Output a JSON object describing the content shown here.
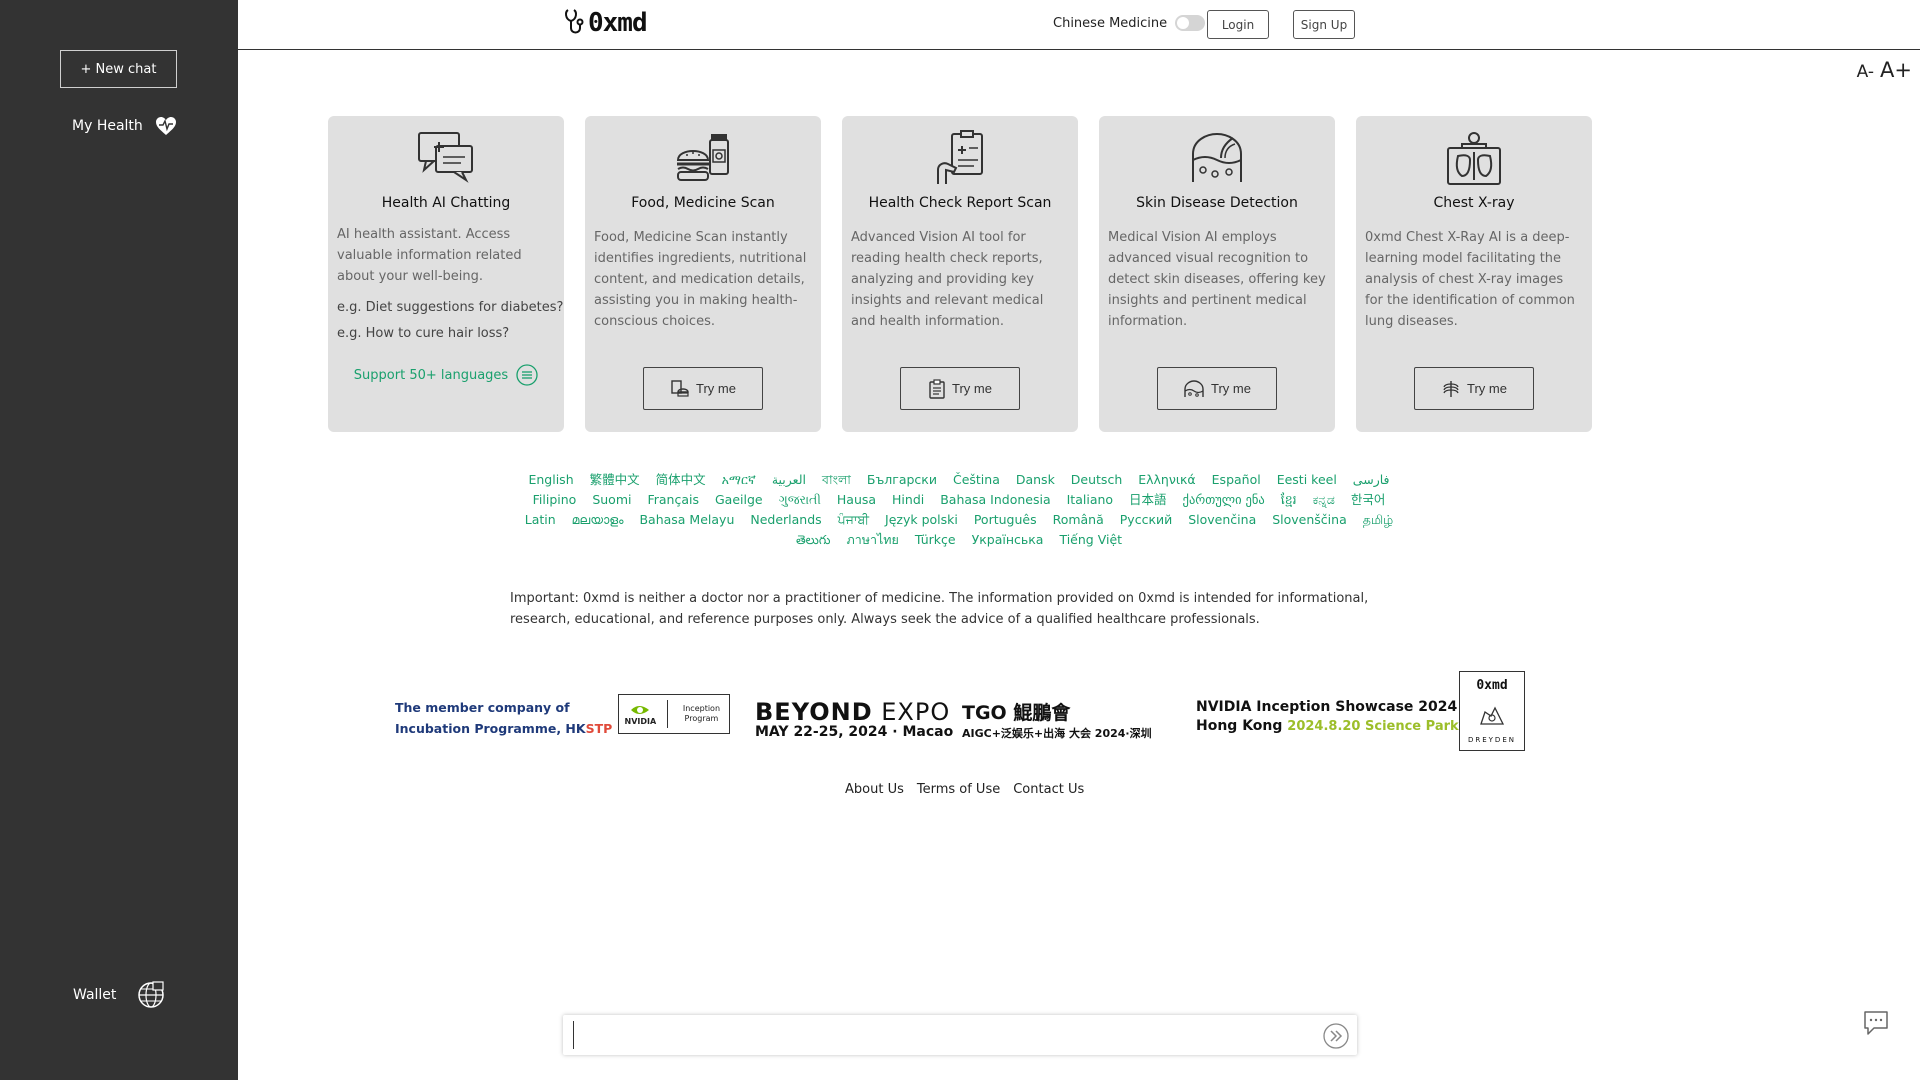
{
  "sidebar": {
    "new_chat": "+ New chat",
    "my_health": "My Health",
    "wallet": "Wallet"
  },
  "header": {
    "logo": "0xmd",
    "chinese_medicine": "Chinese Medicine",
    "login": "Login",
    "signup": "Sign Up",
    "font_smaller": "A-",
    "font_larger": "A+"
  },
  "cards": [
    {
      "title": "Health AI Chatting",
      "desc": "AI health assistant. Access valuable information related about your well-being.",
      "example1": "e.g. Diet suggestions for diabetes?",
      "example2": "e.g. How to cure hair loss?",
      "support": "Support 50+ languages"
    },
    {
      "title": "Food, Medicine Scan",
      "desc": "Food, Medicine Scan instantly identifies ingredients, nutritional content, and medication details, assisting you in making health-conscious choices.",
      "try": "Try me"
    },
    {
      "title": "Health Check Report Scan",
      "desc": "Advanced Vision AI tool for reading health check reports, analyzing and providing key insights and relevant medical and health information.",
      "try": "Try me"
    },
    {
      "title": "Skin Disease Detection",
      "desc": "Medical Vision AI employs advanced visual recognition to detect skin diseases, offering key insights and pertinent medical information.",
      "try": "Try me"
    },
    {
      "title": "Chest X-ray",
      "desc": "0xmd Chest X-Ray AI is a deep-learning model facilitating the analysis of chest X-ray images for the identification of common lung diseases.",
      "try": "Try me"
    }
  ],
  "languages": [
    "English",
    "繁體中文",
    "简体中文",
    "አማርኛ",
    "العربية",
    "বাংলা",
    "Български",
    "Čeština",
    "Dansk",
    "Deutsch",
    "Ελληνικά",
    "Español",
    "Eesti keel",
    "فارسی",
    "Filipino",
    "Suomi",
    "Français",
    "Gaeilge",
    "ગુજરાતી",
    "Hausa",
    "Hindi",
    "Bahasa Indonesia",
    "Italiano",
    "日本語",
    "ქართული ენა",
    "ខ្មែរ",
    "ಕನ್ನಡ",
    "한국어",
    "Latin",
    "മലയാളം",
    "Bahasa Melayu",
    "Nederlands",
    "ਪੰਜਾਬੀ",
    "Język polski",
    "Português",
    "Română",
    "Русский",
    "Slovenčina",
    "Slovenščina",
    "தமிழ்",
    "తెలుగు",
    "ภาษาไทย",
    "Türkçe",
    "Українська",
    "Tiếng Việt"
  ],
  "disclaimer": "Important: 0xmd is neither a doctor nor a practitioner of medicine. The information provided on 0xmd is intended for informational, research, educational, and reference purposes only. Always seek the advice of a qualified healthcare professionals.",
  "partners": {
    "hkstp_line1": "The member company of",
    "hkstp_line2a": "Incubation Programme, HK",
    "hkstp_line2b": "STP",
    "nvidia_brand": "NVIDIA",
    "nvidia_program": "Inception Program",
    "beyond_a": "BEYOND",
    "beyond_b": " EXPO",
    "beyond_date": "MAY 22-25, 2024 · Macao",
    "tgo_title": "TGO 鯤鵬會",
    "tgo_sub": "AIGC+泛娱乐+出海 大会 2024·深圳",
    "showcase_line1": "NVIDIA Inception Showcase 2024",
    "showcase_line2a": "Hong Kong ",
    "showcase_line2b": "2024.8.20 Science Park",
    "dreyden_logo": "0xmd",
    "dreyden_name": "DREYDEN"
  },
  "footer": {
    "about": "About Us",
    "terms": "Terms of Use",
    "contact": "Contact Us"
  },
  "chat": {
    "placeholder": ""
  },
  "colors": {
    "sidebar_bg": "#333333",
    "card_bg": "#e0e0e0",
    "accent_green": "#1aa06d"
  }
}
